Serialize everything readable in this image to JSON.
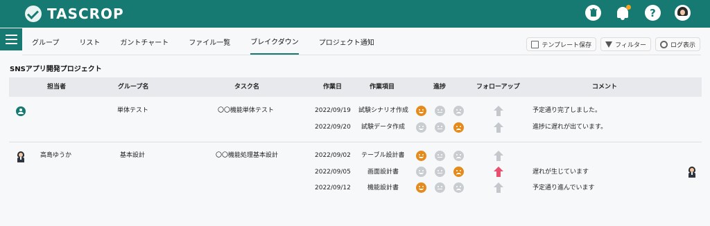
{
  "app": {
    "name": "TASCROP"
  },
  "topbar": {
    "icons": [
      "trash-icon",
      "bell-icon",
      "help-icon",
      "user-avatar"
    ],
    "help_glyph": "?",
    "trash_glyph": "🗑"
  },
  "tabs": [
    {
      "label": "グループ"
    },
    {
      "label": "リスト"
    },
    {
      "label": "ガントチャート"
    },
    {
      "label": "ファイル一覧"
    },
    {
      "label": "ブレイクダウン",
      "active": true
    },
    {
      "label": "プロジェクト通知"
    }
  ],
  "tools": {
    "template_save": "テンプレート保存",
    "filter": "フィルター",
    "log": "ログ表示"
  },
  "project": {
    "title": "SNSアプリ開発プロジェクト"
  },
  "table": {
    "headers": {
      "assignee": "担当者",
      "group": "グループ名",
      "task": "タスク名",
      "date": "作業日",
      "item": "作業項目",
      "progress": "進捗",
      "followup": "フォローアップ",
      "comment": "コメント"
    },
    "groups": [
      {
        "assignee": "",
        "group": "単体テスト",
        "task": "〇〇機能単体テスト",
        "rows": [
          {
            "date": "2022/09/19",
            "item": "試験シナリオ作成",
            "progress": "good",
            "followup": "none",
            "comment": "予定通り完了しました。"
          },
          {
            "date": "2022/09/20",
            "item": "試験データ作成",
            "progress": "bad",
            "followup": "none",
            "comment": "進捗に遅れが出ています。"
          }
        ]
      },
      {
        "assignee": "高島ゆうか",
        "group": "基本設計",
        "task": "〇〇機能処理基本設計",
        "rows": [
          {
            "date": "2022/09/02",
            "item": "テーブル設計書",
            "progress": "good",
            "followup": "none",
            "comment": ""
          },
          {
            "date": "2022/09/05",
            "item": "画面設計書",
            "progress": "bad",
            "followup": "raised",
            "comment": "遅れが生じています"
          },
          {
            "date": "2022/09/12",
            "item": "機能設計書",
            "progress": "good",
            "followup": "none",
            "comment": "予定通り進んでいます"
          }
        ]
      }
    ]
  },
  "colors": {
    "brand": "#177a72",
    "good": "#e58b1c",
    "bad": "#e58b1c",
    "neutral": "#c9ccd0",
    "followup_raised": "#e8506f"
  }
}
